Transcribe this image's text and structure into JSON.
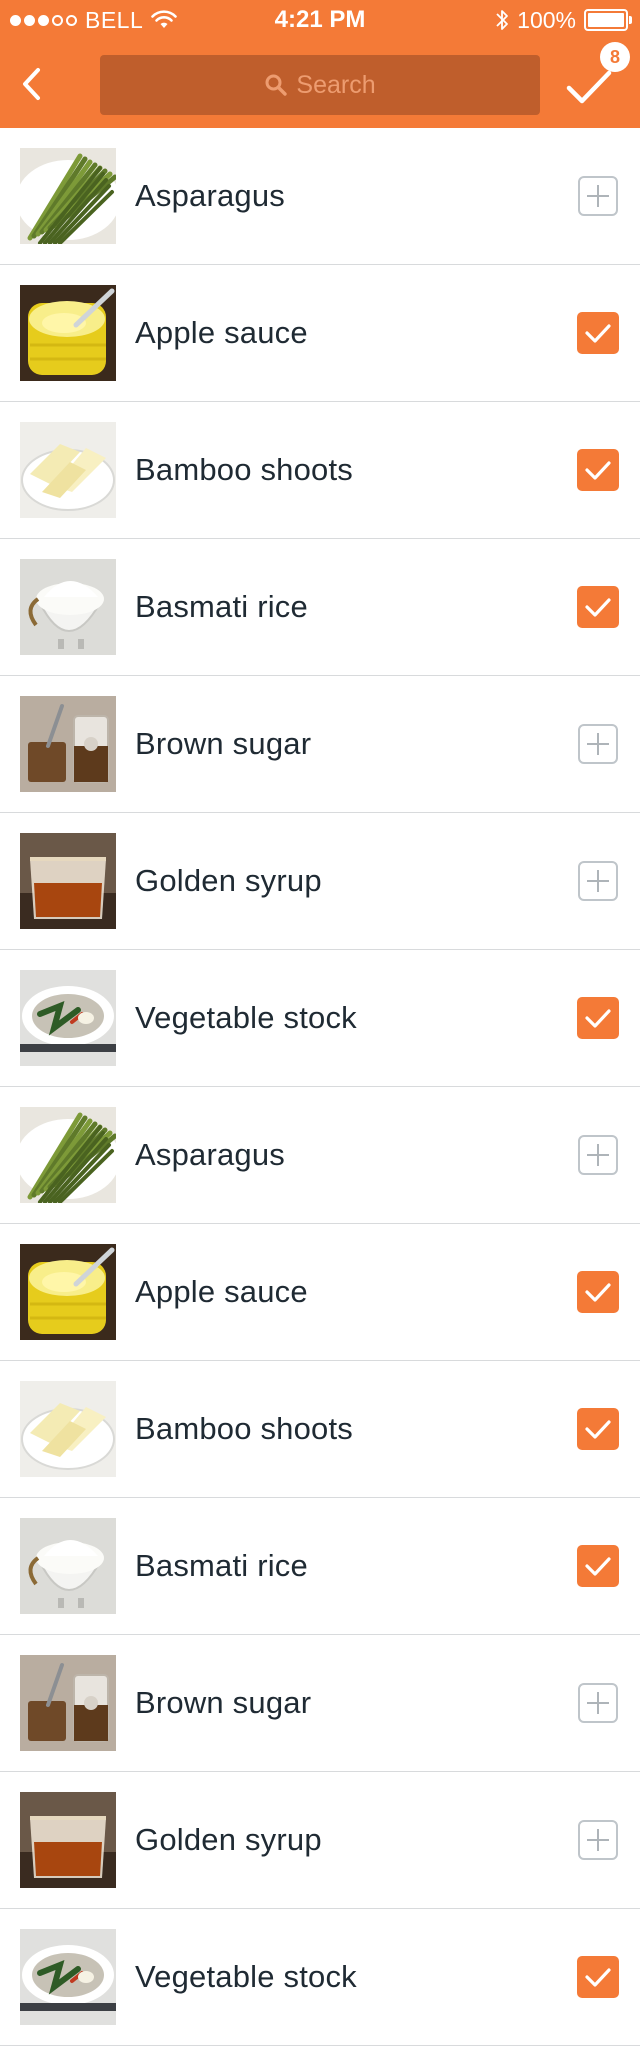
{
  "status_bar": {
    "carrier": "BELL",
    "time": "4:21 PM",
    "battery": "100%",
    "signal_bars_filled": 3,
    "signal_bars_total": 5
  },
  "header": {
    "back_icon": "chevron-left-icon",
    "search_placeholder": "Search",
    "done_icon": "checkmark-icon",
    "selected_count": "8",
    "accent_color": "#f47a37"
  },
  "items": [
    {
      "label": "Asparagus",
      "image": "asparagus",
      "selected": false
    },
    {
      "label": "Apple sauce",
      "image": "apple-sauce",
      "selected": true
    },
    {
      "label": "Bamboo shoots",
      "image": "bamboo-shoots",
      "selected": true
    },
    {
      "label": "Basmati rice",
      "image": "basmati-rice",
      "selected": true
    },
    {
      "label": "Brown sugar",
      "image": "brown-sugar",
      "selected": false
    },
    {
      "label": "Golden syrup",
      "image": "golden-syrup",
      "selected": false
    },
    {
      "label": "Vegetable stock",
      "image": "vegetable-stock",
      "selected": true
    },
    {
      "label": "Asparagus",
      "image": "asparagus",
      "selected": false
    },
    {
      "label": "Apple sauce",
      "image": "apple-sauce",
      "selected": true
    },
    {
      "label": "Bamboo shoots",
      "image": "bamboo-shoots",
      "selected": true
    },
    {
      "label": "Basmati rice",
      "image": "basmati-rice",
      "selected": true
    },
    {
      "label": "Brown sugar",
      "image": "brown-sugar",
      "selected": false
    },
    {
      "label": "Golden syrup",
      "image": "golden-syrup",
      "selected": false
    },
    {
      "label": "Vegetable stock",
      "image": "vegetable-stock",
      "selected": true
    }
  ]
}
